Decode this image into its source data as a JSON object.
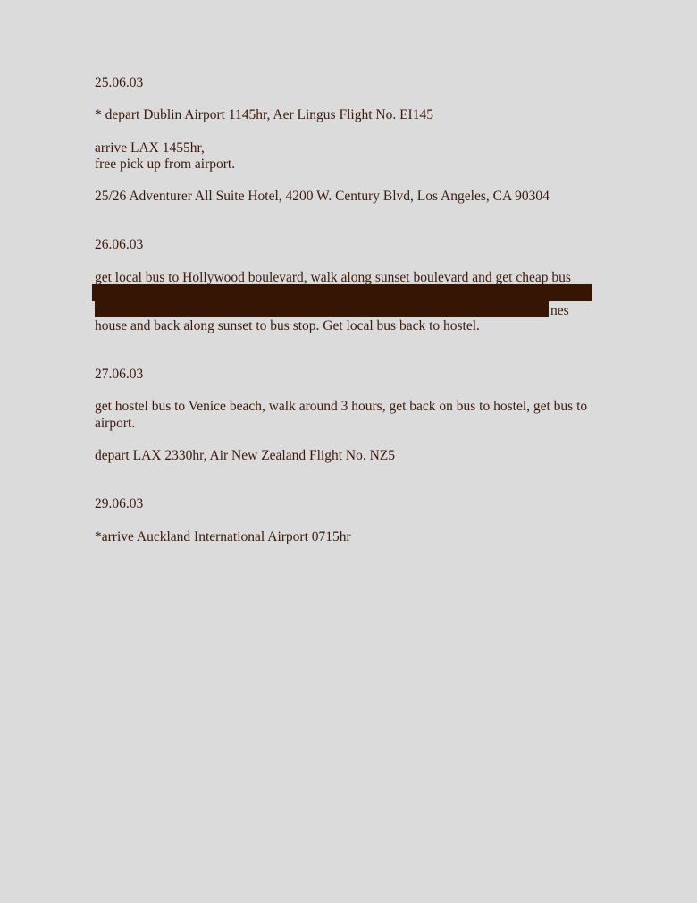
{
  "entries": [
    {
      "date": "25.06.03",
      "lines": [
        "* depart Dublin Airport 1145hr, Aer Lingus Flight No. EI145",
        "arrive LAX 1455hr,",
        "free pick up from airport.",
        "25/26 Adventurer All Suite Hotel, 4200 W. Century Blvd, Los Angeles, CA 90304"
      ]
    },
    {
      "date": "26.06.03",
      "lines": [
        "get local bus to Hollywood boulevard, walk along sunset boulevard and get cheap bus",
        "nes",
        "house and back along sunset to bus stop. Get local bus back to hostel."
      ]
    },
    {
      "date": "27.06.03",
      "lines": [
        "get hostel bus to Venice beach, walk around 3 hours, get back on bus to hostel, get bus to",
        "airport.",
        "depart LAX 2330hr, Air New Zealand Flight No. NZ5"
      ]
    },
    {
      "date": "29.06.03",
      "lines": [
        "*arrive Auckland International Airport 0715hr"
      ]
    }
  ],
  "redaction_color": "#361505"
}
